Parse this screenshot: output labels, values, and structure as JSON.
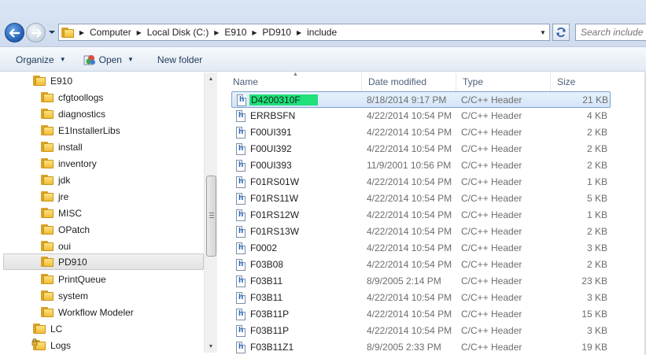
{
  "address": {
    "crumbs": [
      "Computer",
      "Local Disk (C:)",
      "E910",
      "PD910",
      "include"
    ],
    "search_placeholder": "Search include"
  },
  "toolbar": {
    "organize_label": "Organize",
    "open_label": "Open",
    "new_folder_label": "New folder"
  },
  "nav": {
    "items": [
      {
        "label": "E910",
        "indent": 0
      },
      {
        "label": "cfgtoollogs",
        "indent": 1
      },
      {
        "label": "diagnostics",
        "indent": 1
      },
      {
        "label": "E1InstallerLibs",
        "indent": 1
      },
      {
        "label": "install",
        "indent": 1
      },
      {
        "label": "inventory",
        "indent": 1
      },
      {
        "label": "jdk",
        "indent": 1
      },
      {
        "label": "jre",
        "indent": 1
      },
      {
        "label": "MISC",
        "indent": 1
      },
      {
        "label": "OPatch",
        "indent": 1
      },
      {
        "label": "oui",
        "indent": 1
      },
      {
        "label": "PD910",
        "indent": 1,
        "selected": true
      },
      {
        "label": "PrintQueue",
        "indent": 1
      },
      {
        "label": "system",
        "indent": 1
      },
      {
        "label": "Workflow Modeler",
        "indent": 1
      },
      {
        "label": "LC",
        "indent": 0
      },
      {
        "label": "Logs",
        "indent": 0,
        "locked": true
      }
    ]
  },
  "columns": {
    "name": "Name",
    "date": "Date modified",
    "type": "Type",
    "size": "Size"
  },
  "files": [
    {
      "name": "D4200310F",
      "date": "8/18/2014 9:17 PM",
      "type": "C/C++ Header",
      "size": "21 KB",
      "selected": true,
      "renaming": true
    },
    {
      "name": "ERRBSFN",
      "date": "4/22/2014 10:54 PM",
      "type": "C/C++ Header",
      "size": "4 KB"
    },
    {
      "name": "F00UI391",
      "date": "4/22/2014 10:54 PM",
      "type": "C/C++ Header",
      "size": "2 KB"
    },
    {
      "name": "F00UI392",
      "date": "4/22/2014 10:54 PM",
      "type": "C/C++ Header",
      "size": "2 KB"
    },
    {
      "name": "F00UI393",
      "date": "11/9/2001 10:56 PM",
      "type": "C/C++ Header",
      "size": "2 KB"
    },
    {
      "name": "F01RS01W",
      "date": "4/22/2014 10:54 PM",
      "type": "C/C++ Header",
      "size": "1 KB"
    },
    {
      "name": "F01RS11W",
      "date": "4/22/2014 10:54 PM",
      "type": "C/C++ Header",
      "size": "5 KB"
    },
    {
      "name": "F01RS12W",
      "date": "4/22/2014 10:54 PM",
      "type": "C/C++ Header",
      "size": "1 KB"
    },
    {
      "name": "F01RS13W",
      "date": "4/22/2014 10:54 PM",
      "type": "C/C++ Header",
      "size": "2 KB"
    },
    {
      "name": "F0002",
      "date": "4/22/2014 10:54 PM",
      "type": "C/C++ Header",
      "size": "3 KB"
    },
    {
      "name": "F03B08",
      "date": "4/22/2014 10:54 PM",
      "type": "C/C++ Header",
      "size": "2 KB"
    },
    {
      "name": "F03B11",
      "date": "8/9/2005 2:14 PM",
      "type": "C/C++ Header",
      "size": "23 KB"
    },
    {
      "name": "F03B11",
      "date": "4/22/2014 10:54 PM",
      "type": "C/C++ Header",
      "size": "3 KB"
    },
    {
      "name": "F03B11P",
      "date": "4/22/2014 10:54 PM",
      "type": "C/C++ Header",
      "size": "15 KB"
    },
    {
      "name": "F03B11P",
      "date": "4/22/2014 10:54 PM",
      "type": "C/C++ Header",
      "size": "3 KB"
    },
    {
      "name": "F03B11Z1",
      "date": "8/9/2005 2:33 PM",
      "type": "C/C++ Header",
      "size": "19 KB"
    }
  ],
  "colors": {
    "selection_bg": "#d4e6fa",
    "rename_highlight": "#20e07a",
    "folder": "#f0bd3a"
  }
}
